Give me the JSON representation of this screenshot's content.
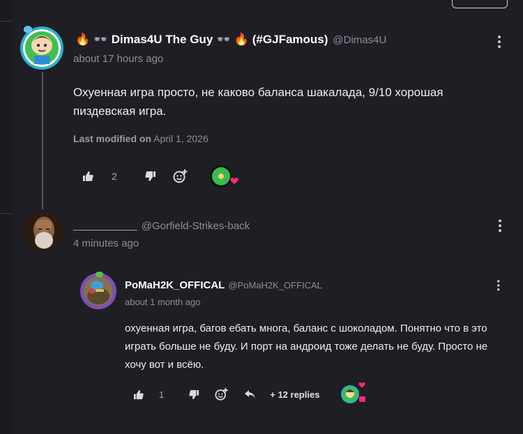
{
  "comment1": {
    "author": "🔥 👓 Dimas4U The Guy 👓 🔥 (#GJFamous)",
    "handle": "@Dimas4U",
    "time": "about 17 hours ago",
    "text": "Охуенная игра просто, не каково баланса шакалада, 9/10 хорошая пиздевская игра.",
    "modified_label": "Last modified on",
    "modified_date": "April 1, 2026",
    "likes": "2"
  },
  "comment2": {
    "author": "___________",
    "handle": "@Gorfield-Strikes-back",
    "time": "4 minutes ago"
  },
  "quoted": {
    "author": "PoMaH2K_OFFICAL",
    "handle": "@PoMaH2K_OFFICAL",
    "time": "about 1 month ago",
    "text": "охуенная игра, багов ебать многа, баланс с шоколадом. Понятно что в это играть больше не буду. И порт на андроид тоже делать не буду. Просто не хочу вот и всёю.",
    "likes": "1",
    "replies_label": "+ 12 replies"
  },
  "colors": {
    "background": "#1f1e25",
    "accent_heart": "#ff2a6d",
    "avatar1_ring": "#27b3c8"
  },
  "icons": [
    "thumbs-up-icon",
    "thumbs-down-icon",
    "add-reaction-icon",
    "reply-icon",
    "kebab-menu-icon",
    "heart-icon"
  ]
}
